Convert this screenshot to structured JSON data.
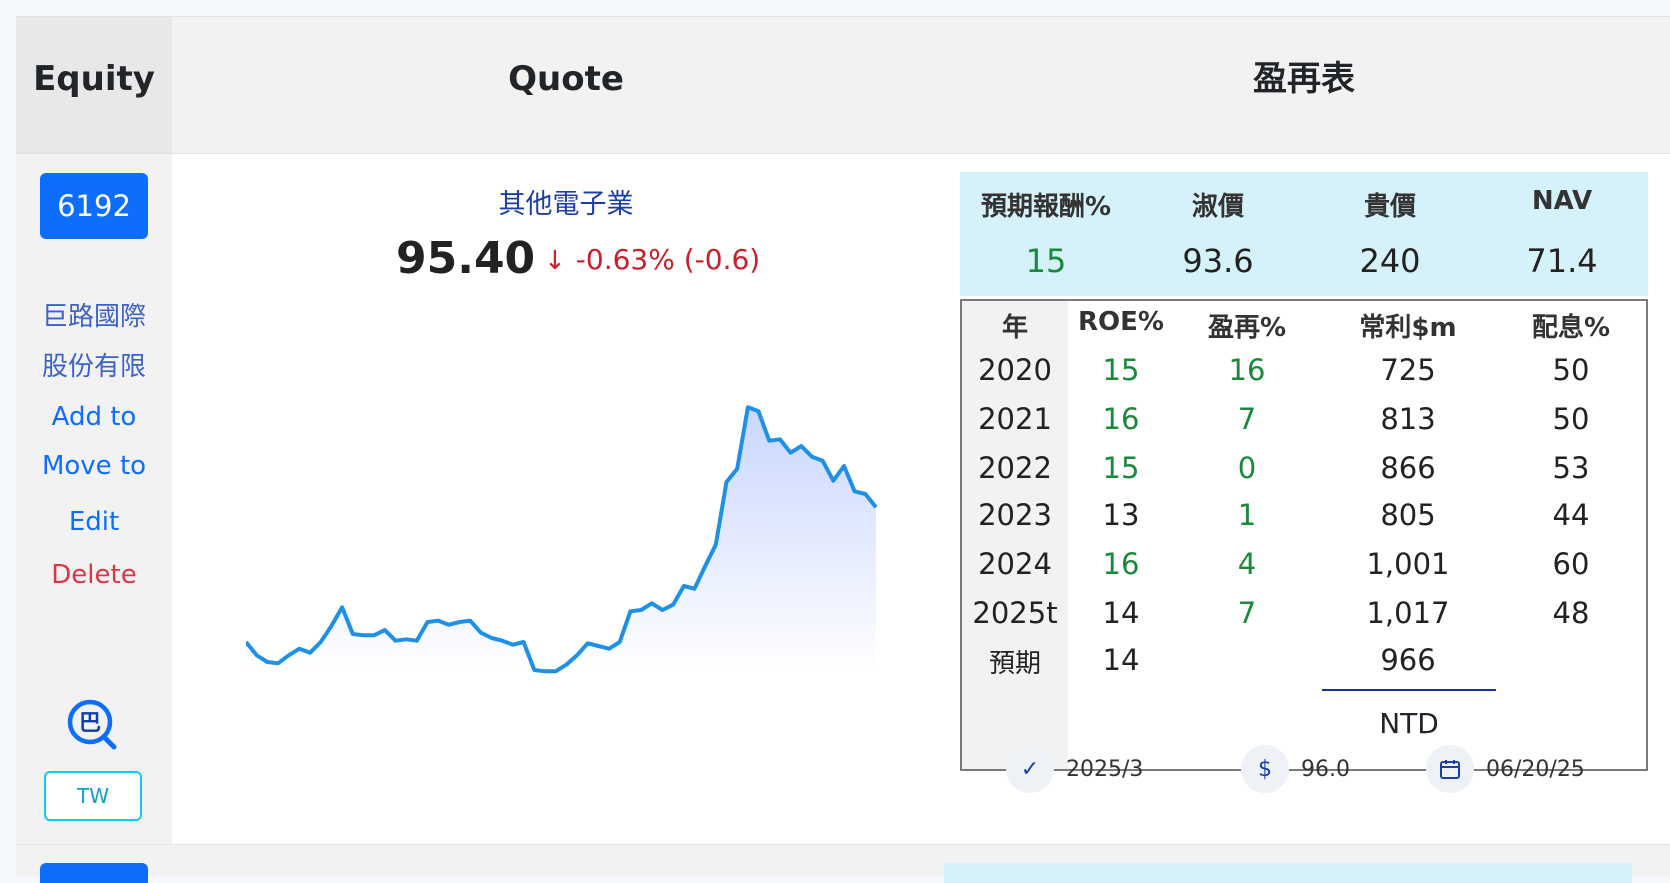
{
  "header": {
    "equity": "Equity",
    "quote": "Quote",
    "table_title": "盈再表"
  },
  "stock": {
    "code": "6192",
    "name_line1": "巨路國際",
    "name_line2": "股份有限",
    "add_to": "Add to",
    "move_to": "Move to",
    "edit": "Edit",
    "delete": "Delete",
    "search_icon_glyph": "巴",
    "market": "TW"
  },
  "quote": {
    "industry": "其他電子業",
    "price": "95.40",
    "arrow": "↓",
    "change": "-0.63% (-0.6)",
    "sparkline": [
      27,
      26,
      25.5,
      25.4,
      26,
      26.5,
      26.2,
      27,
      28.2,
      29.6,
      27.6,
      27.5,
      27.5,
      27.9,
      27.1,
      27.2,
      27.1,
      28.5,
      28.6,
      28.3,
      28.5,
      28.6,
      27.7,
      27.3,
      27.1,
      26.8,
      27.0,
      24.9,
      24.8,
      24.8,
      25.3,
      26.0,
      26.9,
      26.7,
      26.5,
      27.0,
      29.3,
      29.4,
      29.9,
      29.4,
      29.8,
      31.2,
      31.0,
      32.7,
      34.3,
      39.0,
      40.0,
      44.6,
      44.3,
      42.1,
      42.2,
      41.2,
      41.7,
      40.9,
      40.6,
      39.1,
      40.2,
      38.3,
      38.1,
      37.1
    ]
  },
  "valuation": {
    "labels": [
      "預期報酬%",
      "淑價",
      "貴價",
      "NAV"
    ],
    "values": [
      "15",
      "93.6",
      "240",
      "71.4"
    ]
  },
  "table": {
    "headers": [
      "年",
      "ROE%",
      "盈再%",
      "常利$m",
      "配息%"
    ],
    "rows": [
      [
        "2020",
        "15",
        "16",
        "725",
        "50"
      ],
      [
        "2021",
        "16",
        "7",
        "813",
        "50"
      ],
      [
        "2022",
        "15",
        "0",
        "866",
        "53"
      ],
      [
        "2023",
        "13",
        "1",
        "805",
        "44"
      ],
      [
        "2024",
        "16",
        "4",
        "1,001",
        "60"
      ],
      [
        "2025t",
        "14",
        "7",
        "1,017",
        "48"
      ],
      [
        "預期",
        "14",
        "",
        "966",
        ""
      ]
    ],
    "currency": "NTD"
  },
  "footer": {
    "report": "2025/3",
    "report_icon": "✓",
    "dollar_icon": "$",
    "price": "96.0",
    "date": "06/20/25"
  },
  "colors": {
    "accent": "#0d6efd",
    "green": "#198a3b",
    "red": "#c9202c",
    "valbg": "#d5f1fa",
    "line": "#1e90e6"
  }
}
